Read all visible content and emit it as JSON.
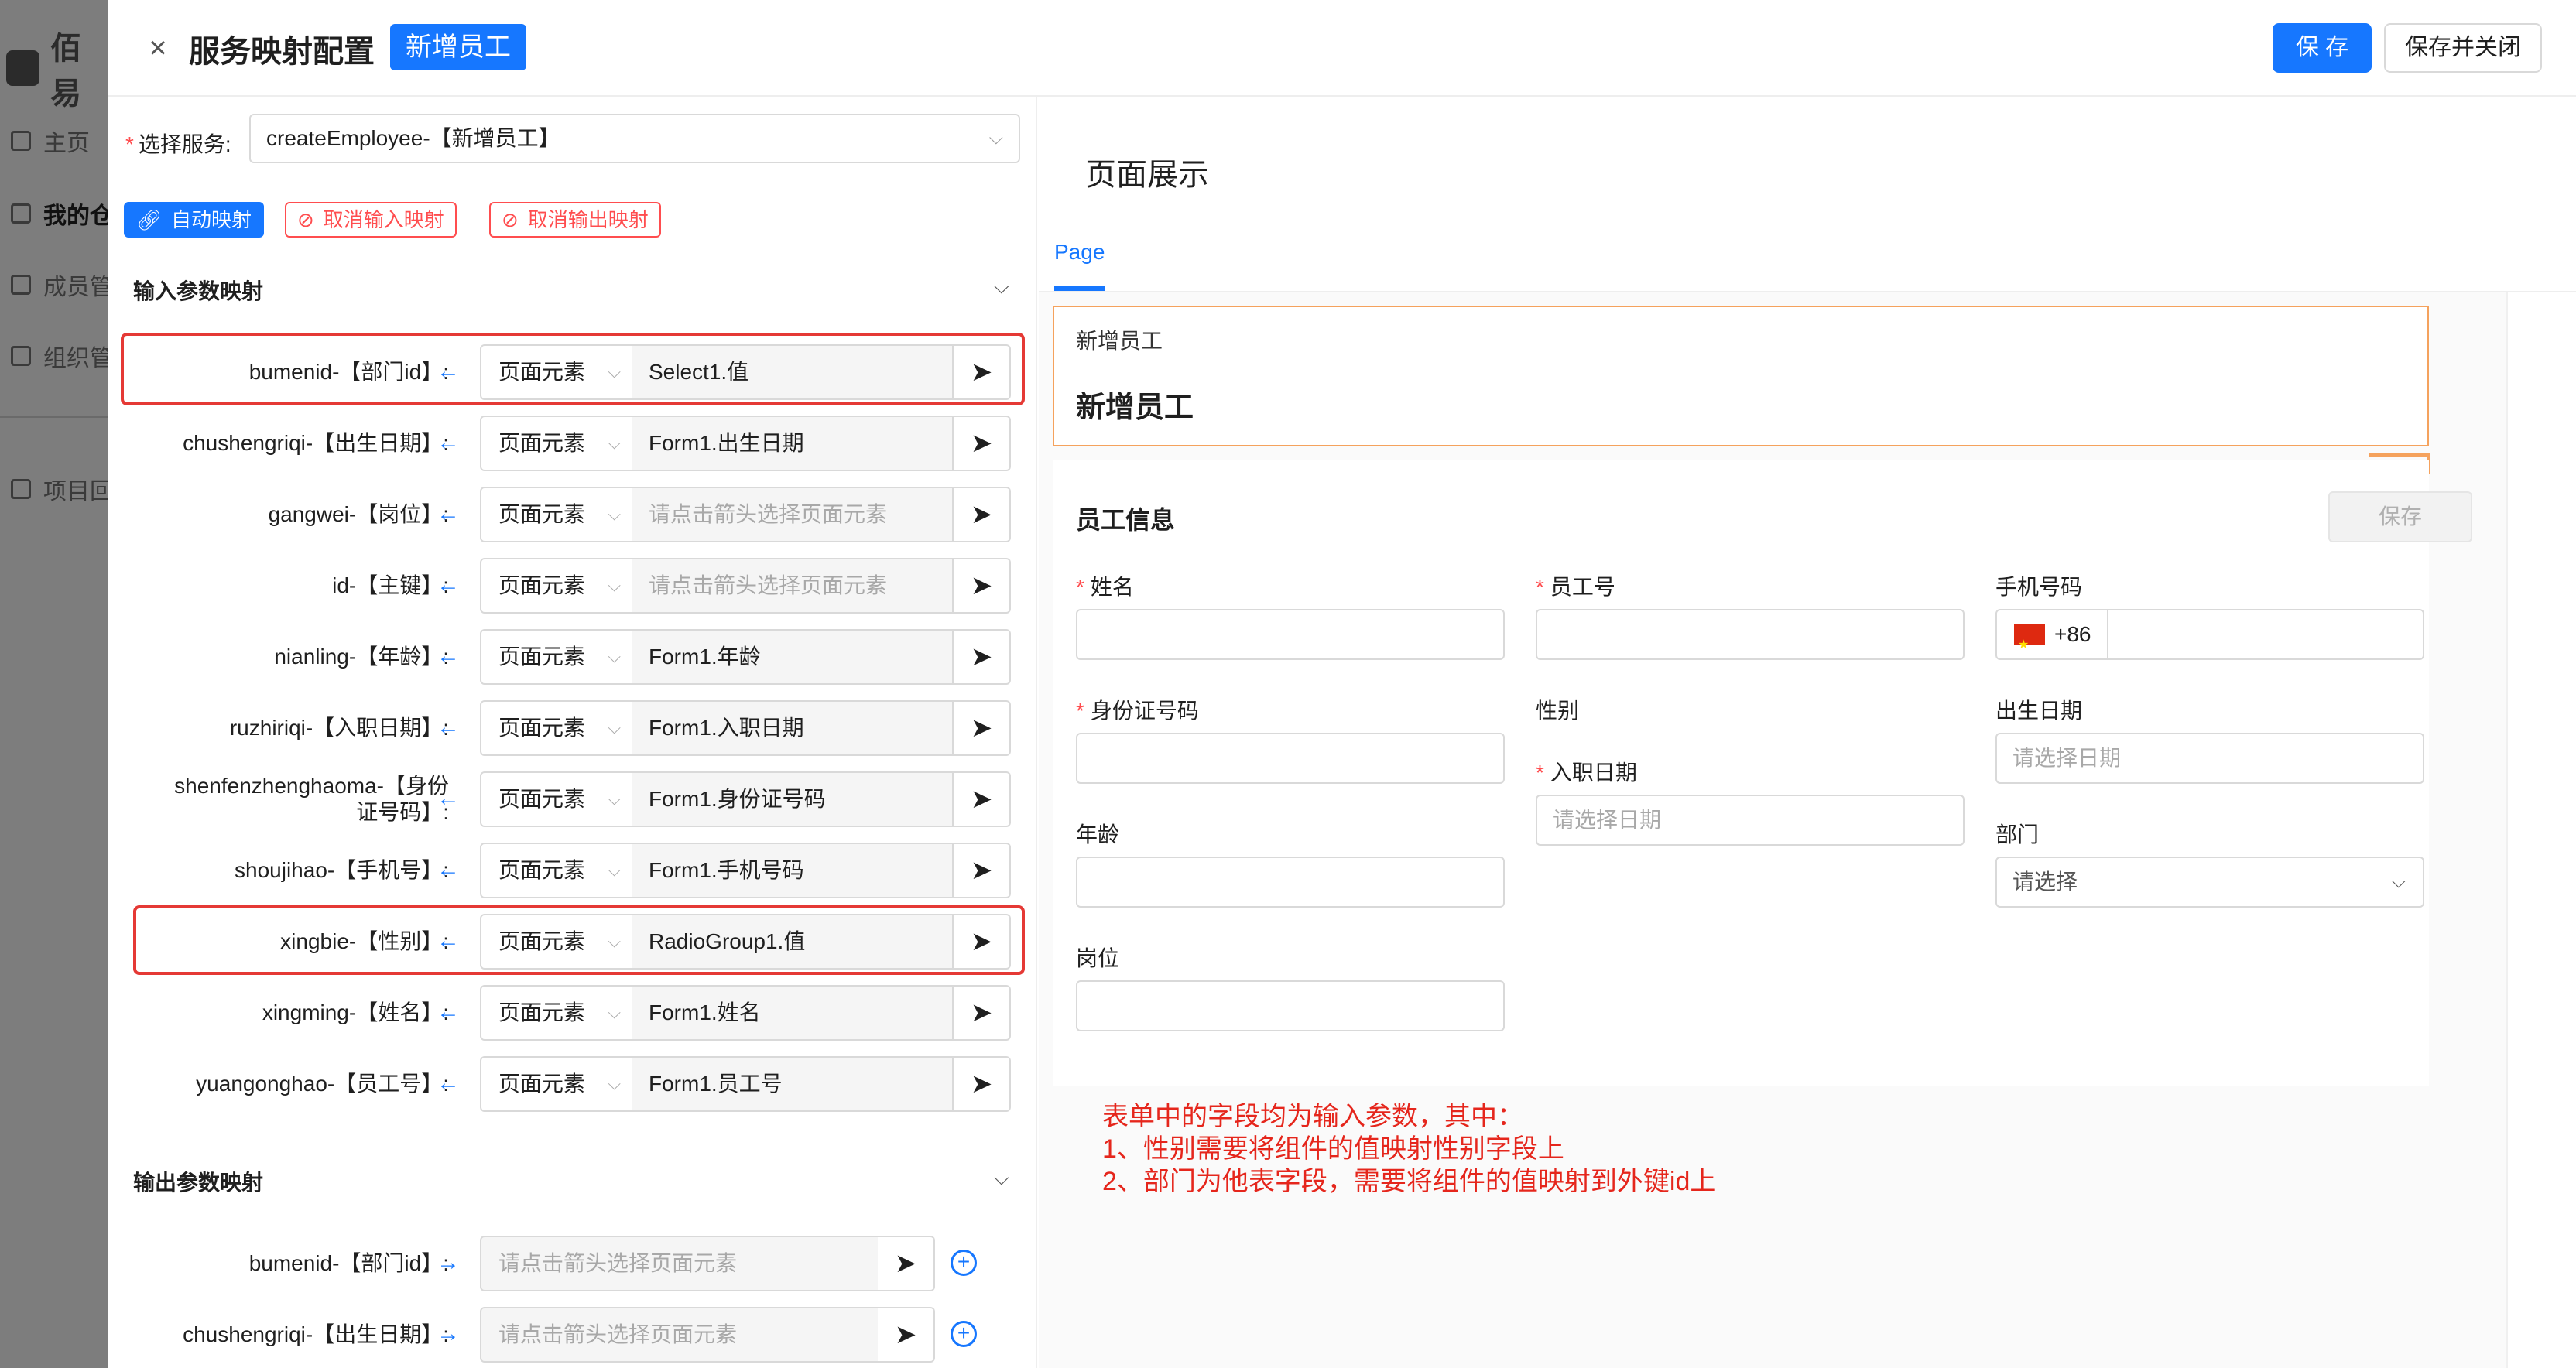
{
  "bg_app": {
    "brand": "佰易",
    "nav": [
      {
        "label": "主页"
      },
      {
        "label": "我的仓"
      },
      {
        "label": "成员管"
      },
      {
        "label": "组织管"
      },
      {
        "label": "项目回"
      }
    ]
  },
  "header": {
    "title": "服务映射配置",
    "tag": "新增员工",
    "save_label": "保 存",
    "save_close_label": "保存并关闭"
  },
  "config": {
    "service_label": "选择服务:",
    "service_value": "createEmployee-【新增员工】",
    "buttons": {
      "auto": "自动映射",
      "cancel_input": "取消输入映射",
      "cancel_output": "取消输出映射"
    },
    "input_section": "输入参数映射",
    "output_section": "输出参数映射",
    "type_label": "页面元素",
    "placeholder": "请点击箭头选择页面元素",
    "input_rows": [
      {
        "label": "bumenid-【部门id】:",
        "value": "Select1.值"
      },
      {
        "label": "chushengriqi-【出生日期】:",
        "value": "Form1.出生日期"
      },
      {
        "label": "gangwei-【岗位】:",
        "value": "请点击箭头选择页面元素"
      },
      {
        "label": "id-【主键】:",
        "value": "请点击箭头选择页面元素"
      },
      {
        "label": "nianling-【年龄】:",
        "value": "Form1.年龄"
      },
      {
        "label": "ruzhiriqi-【入职日期】:",
        "value": "Form1.入职日期"
      },
      {
        "label": "shenfenzhenghaoma-【身份证号码】:",
        "value": "Form1.身份证号码"
      },
      {
        "label": "shoujihao-【手机号】:",
        "value": "Form1.手机号码"
      },
      {
        "label": "xingbie-【性别】:",
        "value": "RadioGroup1.值"
      },
      {
        "label": "xingming-【姓名】:",
        "value": "Form1.姓名"
      },
      {
        "label": "yuangonghao-【员工号】:",
        "value": "Form1.员工号"
      }
    ],
    "output_rows": [
      {
        "label": "bumenid-【部门id】:"
      },
      {
        "label": "chushengriqi-【出生日期】:"
      }
    ]
  },
  "preview": {
    "title": "页面展示",
    "tab": "Page",
    "header_small": "新增员工",
    "header_big": "新增员工",
    "form_title": "员工信息",
    "form_save": "保存",
    "fields": {
      "name": "姓名",
      "emp_no": "员工号",
      "phone": "手机号码",
      "phone_prefix": "+86",
      "id_no": "身份证号码",
      "gender": "性别",
      "birth": "出生日期",
      "birth_ph": "请选择日期",
      "hire": "入职日期",
      "hire_ph": "请选择日期",
      "age": "年龄",
      "dept": "部门",
      "dept_ph": "请选择",
      "post": "岗位"
    },
    "note": [
      "表单中的字段均为输入参数，其中：",
      "1、性别需要将组件的值映射性别字段上",
      "2、部门为他表字段，需要将组件的值映射到外键id上"
    ]
  }
}
